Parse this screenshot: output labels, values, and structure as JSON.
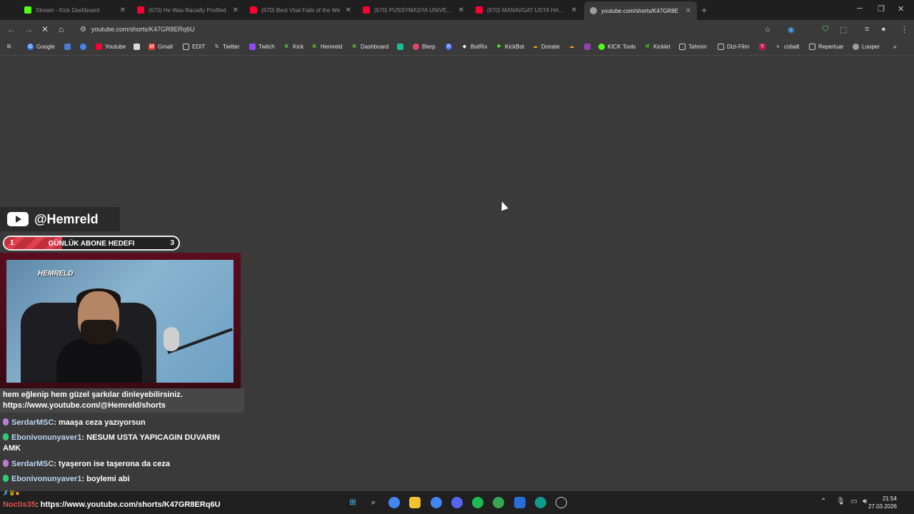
{
  "tabs": [
    {
      "title": "Stream - Kick Dashboard",
      "color": "#53fc18",
      "active": false
    },
    {
      "title": "(670) He Was Racially Profiled",
      "color": "#ff0033",
      "active": false
    },
    {
      "title": "(670) Best Viral Fails of the We",
      "color": "#ff0033",
      "active": false
    },
    {
      "title": "(670) PUSSYMASYA UNIVERSIT",
      "color": "#ff0033",
      "active": false
    },
    {
      "title": "(670) MANAVGAT USTA HACKI",
      "color": "#ff0033",
      "active": false
    },
    {
      "title": "youtube.com/shorts/K47GR8E",
      "color": "#9aa0a6",
      "active": true
    }
  ],
  "address": {
    "url": "youtube.com/shorts/K47GR8ERq6U"
  },
  "bookmarks": [
    {
      "label": "",
      "icon": "apps-icon"
    },
    {
      "label": "Google",
      "icon": "google-icon",
      "color": "#4285f4"
    },
    {
      "label": "",
      "icon": "translate-icon",
      "color": "#4a7bd0"
    },
    {
      "label": "",
      "icon": "chrome-icon",
      "color": "#4285f4"
    },
    {
      "label": "Youtube",
      "icon": "youtube-icon",
      "color": "#ff0033"
    },
    {
      "label": "",
      "icon": "page-icon",
      "color": "#d9d9d9"
    },
    {
      "label": "Gmail",
      "icon": "gmail-icon",
      "color": "#ea4335"
    },
    {
      "label": "EDIT",
      "icon": "folder-icon",
      "color": "#3a3a3a"
    },
    {
      "label": "Twitter",
      "icon": "x-icon",
      "color": "#000000"
    },
    {
      "label": "Twitch",
      "icon": "twitch-icon",
      "color": "#9146ff"
    },
    {
      "label": "Kick",
      "icon": "kick-icon",
      "color": "#53fc18"
    },
    {
      "label": "Hemreld",
      "icon": "kick-icon",
      "color": "#53fc18"
    },
    {
      "label": "Dashboard",
      "icon": "kick-icon",
      "color": "#53fc18"
    },
    {
      "label": "",
      "icon": "bot-icon",
      "color": "#1abc9c"
    },
    {
      "label": "Blerp",
      "icon": "blerp-icon",
      "color": "#e5466c"
    },
    {
      "label": "",
      "icon": "r-icon",
      "color": "#4a6cf7"
    },
    {
      "label": "BotRix",
      "icon": "botrix-icon",
      "color": "#ffffff"
    },
    {
      "label": "KickBot",
      "icon": "kickbot-icon",
      "color": "#53fc18"
    },
    {
      "label": "Donate",
      "icon": "donate-icon",
      "color": "#f5a623"
    },
    {
      "label": "",
      "icon": "coin-icon",
      "color": "#f5a623"
    },
    {
      "label": "",
      "icon": "shield-purple-icon",
      "color": "#8e44ad"
    },
    {
      "label": "KICK Tools",
      "icon": "kick-icon",
      "color": "#53fc18"
    },
    {
      "label": "Kicklet",
      "icon": "kicklet-icon",
      "color": "#53fc18"
    },
    {
      "label": "Tahmin",
      "icon": "folder-icon",
      "color": "#3a3a3a"
    },
    {
      "label": "Dizi-Film",
      "icon": "folder-icon",
      "color": "#3a3a3a"
    },
    {
      "label": "",
      "icon": "y-icon",
      "color": "#c2185b"
    },
    {
      "label": "cobalt",
      "icon": "cobalt-icon",
      "color": "#000000"
    },
    {
      "label": "Repertuar",
      "icon": "folder-icon",
      "color": "#3a3a3a"
    },
    {
      "label": "Looper",
      "icon": "looper-icon",
      "color": "#9e9e9e"
    }
  ],
  "overlay": {
    "handle": "@Hemreld",
    "goal": {
      "label": "GÜNLÜK ABONE HEDEFI",
      "current": "1",
      "target": "3",
      "progress": 0.33
    },
    "cam_logo": "HEMRELD",
    "pinned_lines": [
      "hem eğlenip hem güzel şarkılar dinleyebilirsiniz.",
      "https://www.youtube.com/@Hemreld/shorts"
    ]
  },
  "chat": [
    {
      "user": "SerdarMSC",
      "text": "maaşa ceza yazıyorsun",
      "color": "#c07ad6"
    },
    {
      "user": "Ebonivonunyaver1",
      "text": "NESUM USTA YAPICAGIN DUVARIN AMK",
      "color": "#2ecc71"
    },
    {
      "user": "SerdarMSC",
      "text": "tyaşeron ise taşerona da ceza",
      "color": "#c07ad6"
    },
    {
      "user": "Ebonivonunyaver1",
      "text": "boylemi abi",
      "color": "#2ecc71"
    }
  ],
  "last_message": {
    "user": "Noctis35",
    "text": "https://www.youtube.com/shorts/K47GR8ERq6U"
  },
  "clock": {
    "time": "21:54",
    "date": "27.03.2026"
  }
}
